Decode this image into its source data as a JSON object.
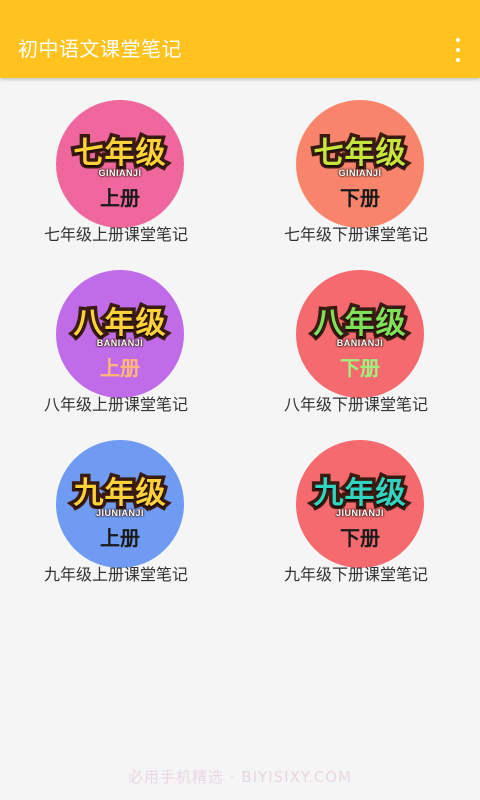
{
  "app_bar": {
    "title": "初中语文课堂笔记",
    "menu_icon": "overflow-vertical-icon",
    "background": "#ffc21f"
  },
  "grades": [
    {
      "grade": "七年级",
      "pinyin": "GINIANJI",
      "volume": "上册",
      "caption": "七年级上册课堂笔记",
      "circle_color": "#f0679e",
      "grade_color": "#ffd23a",
      "volume_color": "#1a1a1a"
    },
    {
      "grade": "七年级",
      "pinyin": "GINIANJI",
      "volume": "下册",
      "caption": "七年级下册课堂笔记",
      "circle_color": "#f8856b",
      "grade_color": "#c6e63e",
      "volume_color": "#1a1a1a"
    },
    {
      "grade": "八年级",
      "pinyin": "BANIANJI",
      "volume": "上册",
      "caption": "八年级上册课堂笔记",
      "circle_color": "#c06ce8",
      "grade_color": "#ffd23a",
      "volume_color": "#ffb877"
    },
    {
      "grade": "八年级",
      "pinyin": "BANIANJI",
      "volume": "下册",
      "caption": "八年级下册课堂笔记",
      "circle_color": "#f46a6f",
      "grade_color": "#7fe05a",
      "volume_color": "#9ff27f"
    },
    {
      "grade": "九年级",
      "pinyin": "JIUNIANJI",
      "volume": "上册",
      "caption": "九年级上册课堂笔记",
      "circle_color": "#6f9cf2",
      "grade_color": "#ffd23a",
      "volume_color": "#1a1a1a"
    },
    {
      "grade": "九年级",
      "pinyin": "JIUNIANJI",
      "volume": "下册",
      "caption": "九年级下册课堂笔记",
      "circle_color": "#f46a6f",
      "grade_color": "#2fd5c0",
      "volume_color": "#1a1a1a"
    }
  ],
  "watermark": "必用手机精选 · BIYISIXY.COM"
}
